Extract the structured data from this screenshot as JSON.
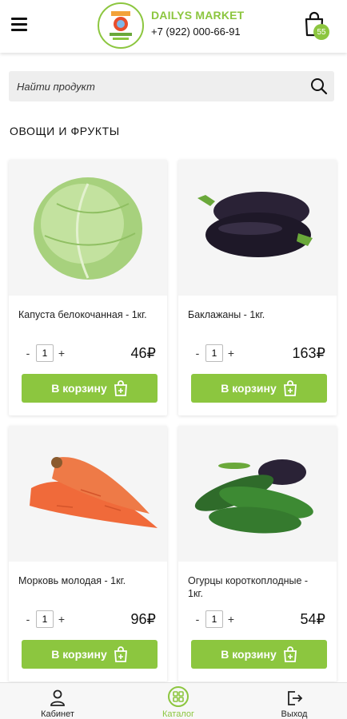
{
  "header": {
    "brand": "DAILYS MARKET",
    "phone": "+7 (922) 000-66-91",
    "cart_count": "55",
    "logo_text": "DAILYS MARKET"
  },
  "search": {
    "placeholder": "Найти продукт"
  },
  "section_title": "ОВОЩИ И ФРУКТЫ",
  "products": [
    {
      "name": "Капуста белокочанная - 1кг.",
      "qty": "1",
      "price": "46₽",
      "button": "В корзину",
      "image": "cabbage"
    },
    {
      "name": "Баклажаны - 1кг.",
      "qty": "1",
      "price": "163₽",
      "button": "В корзину",
      "image": "eggplant"
    },
    {
      "name": "Морковь молодая - 1кг.",
      "qty": "1",
      "price": "96₽",
      "button": "В корзину",
      "image": "carrot"
    },
    {
      "name": "Огурцы короткоплодные - 1кг.",
      "qty": "1",
      "price": "54₽",
      "button": "В корзину",
      "image": "cucumber"
    }
  ],
  "qty_controls": {
    "minus": "-",
    "plus": "+"
  },
  "bottom_nav": [
    {
      "label": "Кабинет",
      "icon": "user-icon"
    },
    {
      "label": "Каталог",
      "icon": "catalog-icon",
      "active": true
    },
    {
      "label": "Выход",
      "icon": "logout-icon"
    }
  ],
  "colors": {
    "accent": "#8cc63f",
    "text": "#111111",
    "search_bg": "#eeeeee"
  }
}
